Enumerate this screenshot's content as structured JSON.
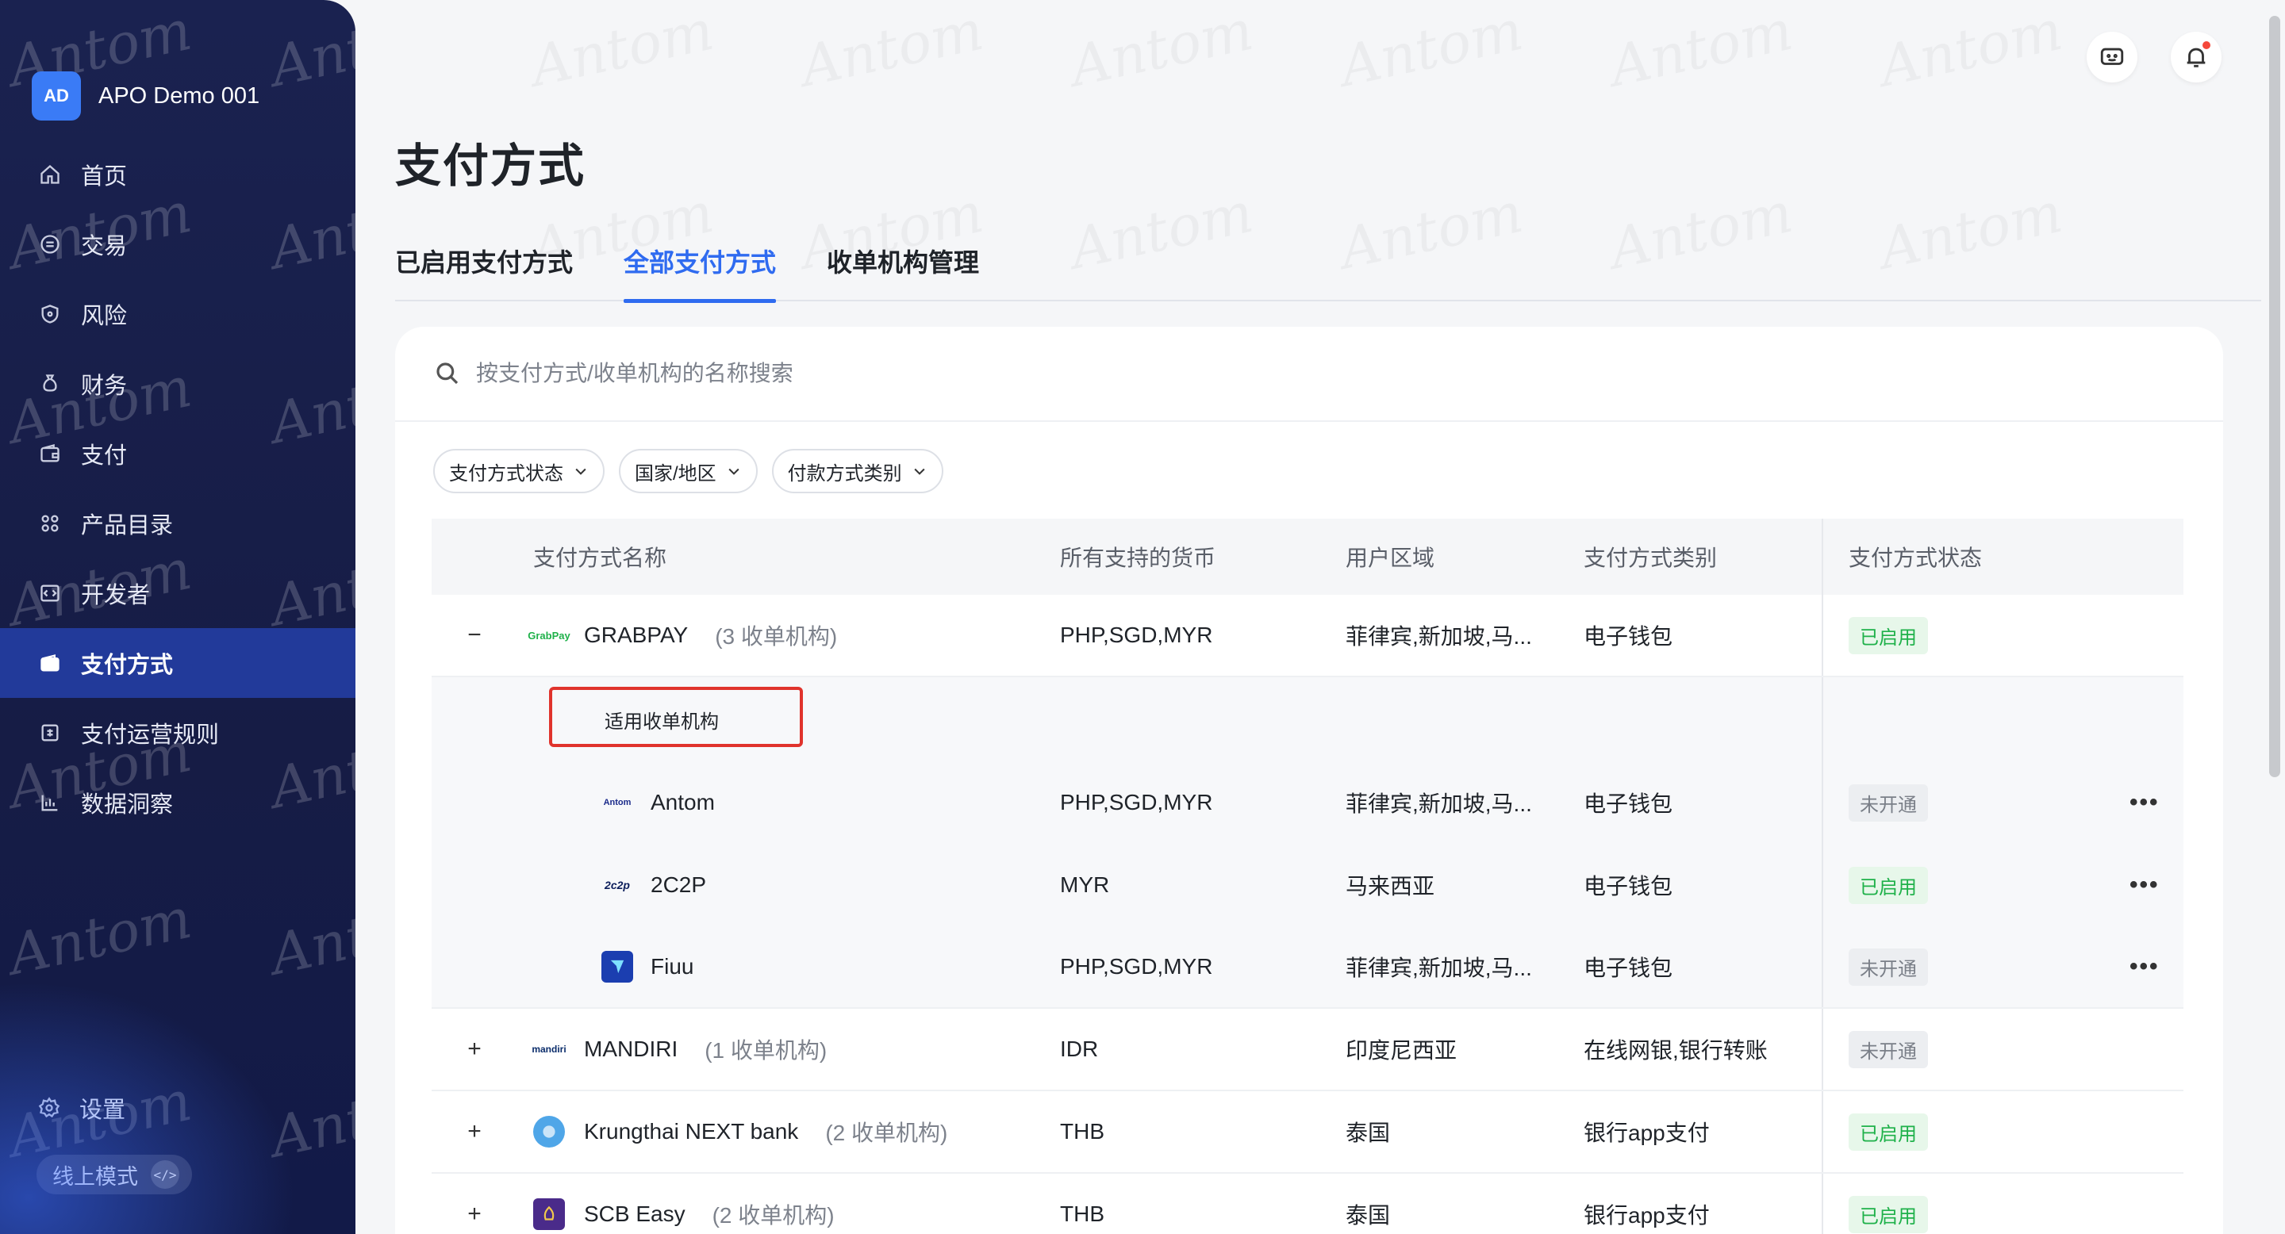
{
  "sidebar": {
    "account": {
      "avatar": "AD",
      "name": "APO Demo 001"
    },
    "items": [
      {
        "label": "首页",
        "icon": "home-icon"
      },
      {
        "label": "交易",
        "icon": "transaction-icon"
      },
      {
        "label": "风险",
        "icon": "shield-icon"
      },
      {
        "label": "财务",
        "icon": "finance-icon"
      },
      {
        "label": "支付",
        "icon": "wallet-icon"
      },
      {
        "label": "产品目录",
        "icon": "grid-icon"
      },
      {
        "label": "开发者",
        "icon": "code-icon"
      },
      {
        "label": "支付方式",
        "icon": "card-wallet-icon",
        "active": true
      },
      {
        "label": "支付运营规则",
        "icon": "rules-icon"
      },
      {
        "label": "数据洞察",
        "icon": "chart-icon"
      }
    ],
    "settings": "设置",
    "mode": "线上模式",
    "mode_icon": "</>"
  },
  "header": {
    "title": "支付方式"
  },
  "tabs": [
    {
      "label": "已启用支付方式"
    },
    {
      "label": "全部支付方式",
      "active": true
    },
    {
      "label": "收单机构管理"
    }
  ],
  "search": {
    "placeholder": "按支付方式/收单机构的名称搜索"
  },
  "filters": [
    {
      "label": "支付方式状态"
    },
    {
      "label": "国家/地区"
    },
    {
      "label": "付款方式类别"
    }
  ],
  "table": {
    "columns": [
      "支付方式名称",
      "所有支持的货币",
      "用户区域",
      "支付方式类别",
      "支付方式状态"
    ],
    "sub_header": "适用收单机构",
    "rows": [
      {
        "expand": "−",
        "logo": "GrabPay",
        "name": "GRABPAY",
        "count": "(3 收单机构)",
        "currency": "PHP,SGD,MYR",
        "region": "菲律宾,新加坡,马...",
        "type": "电子钱包",
        "status": "已启用"
      },
      {
        "expand": "+",
        "logo": "mandiri",
        "name": "MANDIRI",
        "count": "(1 收单机构)",
        "currency": "IDR",
        "region": "印度尼西亚",
        "type": "在线网银,银行转账",
        "status": "未开通"
      },
      {
        "expand": "+",
        "logo": "",
        "name": "Krungthai NEXT bank",
        "count": "(2 收单机构)",
        "currency": "THB",
        "region": "泰国",
        "type": "银行app支付",
        "status": "已启用"
      },
      {
        "expand": "+",
        "logo": "",
        "name": "SCB Easy",
        "count": "(2 收单机构)",
        "currency": "THB",
        "region": "泰国",
        "type": "银行app支付",
        "status": "已启用"
      }
    ],
    "acquirers": [
      {
        "logo": "Antom",
        "name": "Antom",
        "currency": "PHP,SGD,MYR",
        "region": "菲律宾,新加坡,马...",
        "type": "电子钱包",
        "status": "未开通",
        "more": "•••"
      },
      {
        "logo": "2c2p",
        "name": "2C2P",
        "currency": "MYR",
        "region": "马来西亚",
        "type": "电子钱包",
        "status": "已启用",
        "more": "•••"
      },
      {
        "logo": "",
        "name": "Fiuu",
        "currency": "PHP,SGD,MYR",
        "region": "菲律宾,新加坡,马...",
        "type": "电子钱包",
        "status": "未开通",
        "more": "•••"
      }
    ]
  },
  "watermark": "Antom"
}
